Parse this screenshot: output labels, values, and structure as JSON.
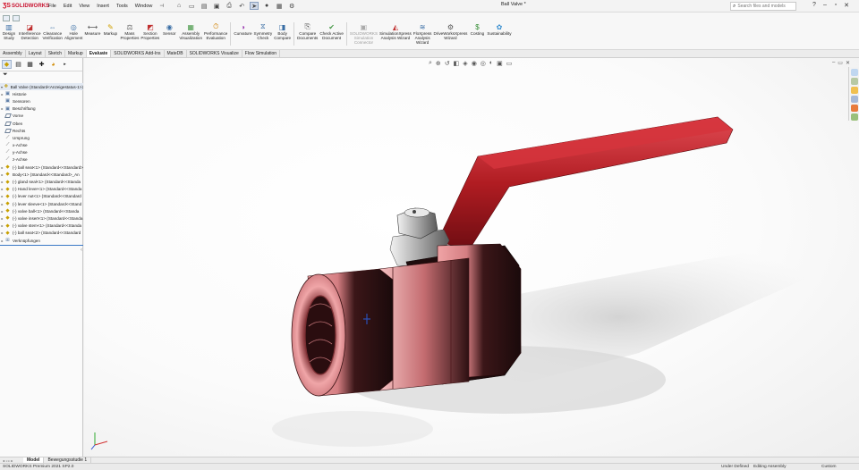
{
  "app": {
    "brand_ds": "ƷS",
    "brand_name": "SOLIDWORKS"
  },
  "menu": [
    "File",
    "Edit",
    "View",
    "Insert",
    "Tools",
    "Window"
  ],
  "document_title": "Ball Valve *",
  "search": {
    "placeholder": "Search files and models"
  },
  "command_manager": {
    "buttons": [
      {
        "label": "Design\nStudy",
        "icon": "design-study-icon",
        "dim": false
      },
      {
        "label": "Interference\nDetection",
        "icon": "interference-icon",
        "dim": false
      },
      {
        "label": "Clearance\nVerification",
        "icon": "clearance-icon",
        "dim": false
      },
      {
        "label": "Hole\nAlignment",
        "icon": "hole-alignment-icon",
        "dim": false
      },
      {
        "label": "Measure",
        "icon": "measure-icon",
        "dim": false
      },
      {
        "label": "Markup",
        "icon": "markup-icon",
        "dim": false
      },
      {
        "label": "Mass\nProperties",
        "icon": "mass-properties-icon",
        "dim": false
      },
      {
        "label": "Section\nProperties",
        "icon": "section-properties-icon",
        "dim": false
      },
      {
        "label": "Sensor",
        "icon": "sensor-icon",
        "dim": false
      },
      {
        "label": "Assembly\nVisualization",
        "icon": "assembly-visualization-icon",
        "dim": false
      },
      {
        "label": "Performance\nEvaluation",
        "icon": "performance-icon",
        "dim": false
      },
      {
        "label": "Curvature",
        "icon": "curvature-icon",
        "dim": false
      },
      {
        "label": "Symmetry\nCheck",
        "icon": "symmetry-icon",
        "dim": false
      },
      {
        "label": "Body\nCompare",
        "icon": "body-compare-icon",
        "dim": false
      },
      {
        "label": "Compare\nDocuments",
        "icon": "compare-docs-icon",
        "dim": false
      },
      {
        "label": "Check Active\nDocument",
        "icon": "check-doc-icon",
        "dim": false
      },
      {
        "label": "SOLIDWORKS\nSimulation\nConnector",
        "icon": "sim-connector-icon",
        "dim": true
      },
      {
        "label": "SimulationXpress\nAnalysis Wizard",
        "icon": "simxpress-icon",
        "dim": false
      },
      {
        "label": "FloXpress\nAnalysis\nWizard",
        "icon": "floxpress-icon",
        "dim": false
      },
      {
        "label": "DriveWorksXpress\nWizard",
        "icon": "driveworks-icon",
        "dim": false
      },
      {
        "label": "Costing",
        "icon": "costing-icon",
        "dim": false
      },
      {
        "label": "Sustainability",
        "icon": "sustainability-icon",
        "dim": false
      }
    ]
  },
  "tabs": [
    {
      "label": "Assembly",
      "active": false
    },
    {
      "label": "Layout",
      "active": false
    },
    {
      "label": "Sketch",
      "active": false
    },
    {
      "label": "Markup",
      "active": false
    },
    {
      "label": "Evaluate",
      "active": true
    },
    {
      "label": "SOLIDWORKS Add-Ins",
      "active": false
    },
    {
      "label": "MateDB",
      "active": false
    },
    {
      "label": "SOLIDWORKS Visualize",
      "active": false
    },
    {
      "label": "Flow Simulation",
      "active": false
    }
  ],
  "tree": {
    "root": "Ball Valve  (Standard<Anzeigestatus-1>)",
    "items": [
      {
        "label": "Historie",
        "icon": "history-icon",
        "type": "folder",
        "expand": true
      },
      {
        "label": "Sensoren",
        "icon": "sensor-icon",
        "type": "folder",
        "expand": false
      },
      {
        "label": "Beschriftung",
        "icon": "annotation-icon",
        "type": "folder",
        "expand": true
      },
      {
        "label": "Vorne",
        "icon": "plane-icon",
        "type": "plane",
        "expand": false
      },
      {
        "label": "Oben",
        "icon": "plane-icon",
        "type": "plane",
        "expand": false
      },
      {
        "label": "Rechts",
        "icon": "plane-icon",
        "type": "plane",
        "expand": false
      },
      {
        "label": "Ursprung",
        "icon": "origin-icon",
        "type": "axis",
        "expand": false
      },
      {
        "label": "x-Achse",
        "icon": "axis-icon",
        "type": "axis",
        "expand": false
      },
      {
        "label": "y-Achse",
        "icon": "axis-icon",
        "type": "axis",
        "expand": false
      },
      {
        "label": "z-Achse",
        "icon": "axis-icon",
        "type": "axis",
        "expand": false
      },
      {
        "label": "(-) ball seat<1> (Standard<<Standard>",
        "icon": "part-icon",
        "type": "part",
        "expand": true
      },
      {
        "label": "Body<1> (Standard<<Standard>_An",
        "icon": "part-icon",
        "type": "part",
        "expand": true
      },
      {
        "label": "(-) gland seal<1> (Standard<<Standa",
        "icon": "part-icon",
        "type": "part",
        "expand": true
      },
      {
        "label": "(-) Hand lever<1> (Standard<<Standa",
        "icon": "part-icon",
        "type": "part",
        "expand": true
      },
      {
        "label": "(-) lever nut<1> (Standard<<Standard",
        "icon": "part-icon",
        "type": "part",
        "expand": true
      },
      {
        "label": "(-) lever sleeve<1> (Standard<<Stand",
        "icon": "part-icon",
        "type": "part",
        "expand": true
      },
      {
        "label": "(-) valve ball<1> (Standard<<Standa",
        "icon": "part-icon",
        "type": "part",
        "expand": true
      },
      {
        "label": "(-) valve insert<1> (Standard<<Standa",
        "icon": "part-icon",
        "type": "part",
        "expand": true
      },
      {
        "label": "(-) valve stem<1> (Standard<<Standa",
        "icon": "part-icon",
        "type": "part",
        "expand": true
      },
      {
        "label": "(-) ball seat<2> (Standard<<Standard",
        "icon": "part-icon",
        "type": "part",
        "expand": true
      }
    ],
    "mates": "Verknüpfungen"
  },
  "bottom_tabs": [
    {
      "label": "Model",
      "active": true
    },
    {
      "label": "Bewegungsstudie 1",
      "active": false
    }
  ],
  "status": {
    "version": "SOLIDWORKS Premium 2021 SP2.0",
    "definition": "Under Defined",
    "mode": "Editing Assembly",
    "units": "Custom"
  },
  "colors": {
    "brand_red": "#c8102e",
    "handle_red": "#b01c22",
    "body_copper": "#d88a8c",
    "body_dark": "#2a1214",
    "accent_blue": "#3a78c6"
  }
}
